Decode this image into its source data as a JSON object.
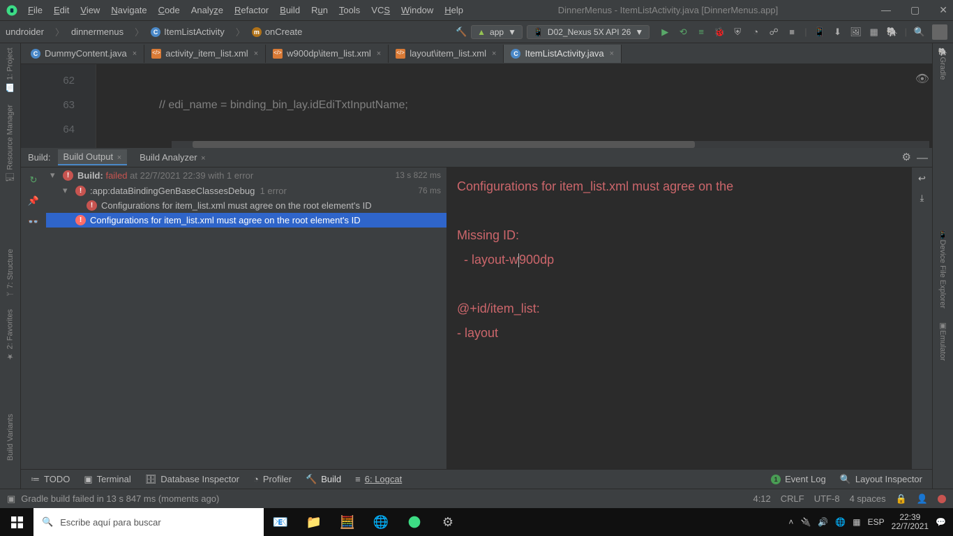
{
  "title": "DinnerMenus - ItemListActivity.java [DinnerMenus.app]",
  "menus": [
    "File",
    "Edit",
    "View",
    "Navigate",
    "Code",
    "Analyze",
    "Refactor",
    "Build",
    "Run",
    "Tools",
    "VCS",
    "Window",
    "Help"
  ],
  "breadcrumbs": {
    "p1": "undroider",
    "p2": "dinnermenus",
    "p3": "ItemListActivity",
    "p4": "onCreate"
  },
  "runConfig": {
    "module": "app",
    "device": "D02_Nexus 5X API 26"
  },
  "tabs": [
    {
      "label": "DummyContent.java",
      "type": "class",
      "active": false
    },
    {
      "label": "activity_item_list.xml",
      "type": "xml",
      "active": false
    },
    {
      "label": "w900dp\\item_list.xml",
      "type": "xml",
      "active": false
    },
    {
      "label": "layout\\item_list.xml",
      "type": "xml",
      "active": false
    },
    {
      "label": "ItemListActivity.java",
      "type": "class",
      "active": true
    }
  ],
  "editor": {
    "lines": [
      "62",
      "63",
      "64"
    ],
    "code63": "// edi_name = binding_bin_lay.idEdiTxtInputName;"
  },
  "buildPanel": {
    "label": "Build:",
    "tabs": {
      "output": "Build Output",
      "analyzer": "Build Analyzer"
    },
    "root": {
      "prefix": "Build:",
      "status": "failed",
      "meta": "at 22/7/2021 22:39 with 1 error",
      "time": "13 s 822 ms"
    },
    "task": {
      "name": ":app:dataBindingGenBaseClassesDebug",
      "meta": "1 error",
      "time": "76 ms"
    },
    "err1": "Configurations for item_list.xml must agree on the root element's ID",
    "err2": "Configurations for item_list.xml must agree on the root element's ID",
    "detail": {
      "l1": "Configurations for item_list.xml must agree on the",
      "l2": "Missing ID:",
      "l3": "  - layout-w900dp",
      "l4": "@+id/item_list:",
      "l5": "  - layout"
    }
  },
  "bottomTools": {
    "todo": "TODO",
    "terminal": "Terminal",
    "db": "Database Inspector",
    "profiler": "Profiler",
    "build": "Build",
    "logcat": "6: Logcat",
    "eventlog": "Event Log",
    "layoutinsp": "Layout Inspector"
  },
  "statusBar": {
    "msg": "Gradle build failed in 13 s 847 ms (moments ago)",
    "pos": "4:12",
    "sep": "CRLF",
    "enc": "UTF-8",
    "indent": "4 spaces"
  },
  "sideTools": {
    "project": "1: Project",
    "resmgr": "Resource Manager",
    "structure": "7: Structure",
    "favorites": "2: Favorites",
    "variants": "Build Variants",
    "gradle": "Gradle",
    "devexp": "Device File Explorer",
    "emulator": "Emulator"
  },
  "taskbar": {
    "searchPlaceholder": "Escribe aquí para buscar",
    "lang": "ESP",
    "time": "22:39",
    "date": "22/7/2021"
  }
}
